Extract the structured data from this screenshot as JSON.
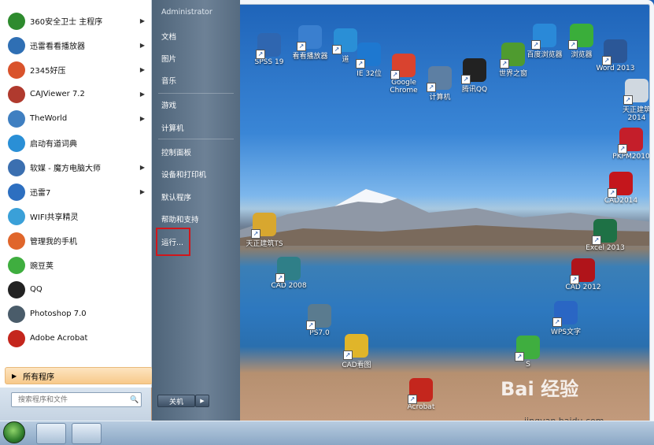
{
  "start_menu": {
    "pinned_header": "Administrator",
    "programs": [
      {
        "label": "360安全卫士 主程序",
        "arrow": true,
        "color": "#2e8b2e"
      },
      {
        "label": "迅雷看看播放器",
        "arrow": true,
        "color": "#2f6fb4"
      },
      {
        "label": "2345好压",
        "arrow": true,
        "color": "#d9532c"
      },
      {
        "label": "CAJViewer 7.2",
        "arrow": true,
        "color": "#b03a2e"
      },
      {
        "label": "TheWorld",
        "arrow": true,
        "color": "#3f7fc1"
      },
      {
        "label": "启动有道词典",
        "arrow": false,
        "color": "#2a8fd6"
      },
      {
        "label": "软媒 - 魔方电脑大师",
        "arrow": true,
        "color": "#3b6fb0"
      },
      {
        "label": "迅雷7",
        "arrow": true,
        "color": "#2d6fc0"
      },
      {
        "label": "WIFI共享精灵",
        "arrow": false,
        "color": "#3aa0d8"
      },
      {
        "label": "管理我的手机",
        "arrow": false,
        "color": "#e0662b"
      },
      {
        "label": "豌豆荚",
        "arrow": false,
        "color": "#3fae3f"
      },
      {
        "label": "QQ",
        "arrow": false,
        "color": "#222222"
      },
      {
        "label": "Photoshop 7.0",
        "arrow": false,
        "color": "#4a5c6a"
      },
      {
        "label": "Adobe Acrobat",
        "arrow": false,
        "color": "#c4261d"
      }
    ],
    "all_programs": "所有程序",
    "search_placeholder": "搜索程序和文件",
    "right_items": [
      {
        "label": "文档"
      },
      {
        "label": "图片"
      },
      {
        "label": "音乐"
      },
      {
        "label": "游戏"
      },
      {
        "label": "计算机"
      },
      {
        "label": "控制面板"
      },
      {
        "label": "设备和打印机"
      },
      {
        "label": "默认程序"
      },
      {
        "label": "帮助和支持"
      },
      {
        "label": "运行..."
      }
    ],
    "shutdown": "关机",
    "shutdown_arrow": "▶"
  },
  "desktop_icons": [
    {
      "label": "SPSS 19",
      "color": "#2f66b0"
    },
    {
      "label": "看看播放器",
      "color": "#3a7fcf"
    },
    {
      "label": "道",
      "color": "#2a8fd6"
    },
    {
      "label": "IE 32位",
      "color": "#1e78d0"
    },
    {
      "label": "Google Chrome",
      "color": "#d9432f"
    },
    {
      "label": "计算机",
      "color": "#5d7fa3"
    },
    {
      "label": "腾讯QQ",
      "color": "#222222"
    },
    {
      "label": "世界之窗",
      "color": "#4f9b2f"
    },
    {
      "label": "百度浏览器",
      "color": "#2a89d8"
    },
    {
      "label": "浏览器",
      "color": "#3aae3a"
    },
    {
      "label": "Word 2013",
      "color": "#2b5797"
    },
    {
      "label": "天正建筑 2014",
      "color": "#d0d8e0"
    },
    {
      "label": "PKPM2010",
      "color": "#c41e2a"
    },
    {
      "label": "CAD2014",
      "color": "#c4161c"
    },
    {
      "label": "天正建筑TS",
      "color": "#d8a72f"
    },
    {
      "label": "CAD 2008",
      "color": "#2f7f88"
    },
    {
      "label": "Excel 2013",
      "color": "#1e7145"
    },
    {
      "label": "CAD 2012",
      "color": "#b0141a"
    },
    {
      "label": "PS7.0",
      "color": "#5a7b8f"
    },
    {
      "label": "WPS文字",
      "color": "#2a66c4"
    },
    {
      "label": "CAD看图",
      "color": "#e0b52a"
    },
    {
      "label": "Acrobat",
      "color": "#c4261d"
    },
    {
      "label": "S",
      "color": "#3fae3f"
    }
  ],
  "watermark": "Bai 经验",
  "watermark_url": "jingyan.baidu.com"
}
